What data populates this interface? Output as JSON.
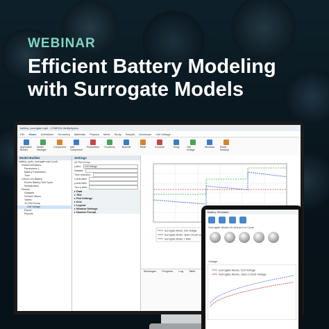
{
  "eyebrow": "WEBINAR",
  "title_line1": "Efficient Battery Modeling",
  "title_line2": "with Surrogate Models",
  "app": {
    "title": "battery_surrogate.mph - COMSOL Multiphysics",
    "menu": [
      "File",
      "Home",
      "Definitions",
      "Geometry",
      "Materials",
      "Physics",
      "Mesh",
      "Study",
      "Results",
      "Developer",
      "Cell Voltage"
    ],
    "active_menu": "Home",
    "ribbon": [
      "Application Builder",
      "Model Manager",
      "Component",
      "Add Component",
      "Parameters",
      "Functions",
      "Build All",
      "Mesh",
      "Compute",
      "Study",
      "Cell Voltage",
      "Windows",
      "Reset Desktop"
    ],
    "model_builder_title": "Model Builder",
    "settings_title": "Settings",
    "settings_subtitle": "1D Plot Group",
    "label_field": "Cell Voltage",
    "tree": [
      "battery_cycle_surrogate.mph (root)",
      "Global Definitions",
      "Parameters 1",
      "Battery Parameters",
      "Time",
      "Lithium Ion Battery",
      "Events Battery Test Cycle",
      "Multiplication",
      "Results",
      "Datasets",
      "Derived Values",
      "Tables",
      "1D Plot Group",
      "Cell Voltage",
      "Export",
      "Reports"
    ],
    "settings_sections": [
      "Data",
      "Title",
      "Plot Settings",
      "Axis",
      "Legend",
      "Window Settings",
      "Number Format"
    ],
    "settings_rows": [
      "Dataset:",
      "Time selection:",
      "x-axis label",
      "y-axis label",
      "Two y-axes"
    ],
    "legend_entries": [
      "Surrogate Model, Cell Voltage",
      "Surrogate Model, Open-Circuit Cell Voltage",
      "Surrogate Model, 1 Rate"
    ],
    "bottom_tabs": [
      "Messages",
      "Progress",
      "Log",
      "Table"
    ]
  },
  "tablet": {
    "title": "Battery Simulator",
    "label": "Surrogate Model of Lithium-Ion Cycle",
    "plot_label": "Voltage",
    "legend_entries": [
      "Surrogate Model, Cell Voltage",
      "Surrogate Model, Open-Circuit Voltage"
    ]
  },
  "colors": {
    "accent": "#7fd6c2",
    "title": "#ffffff",
    "series_cell": "#4a6fd1",
    "series_ocv": "#d23b3b",
    "series_rate": "#3aa84a"
  }
}
